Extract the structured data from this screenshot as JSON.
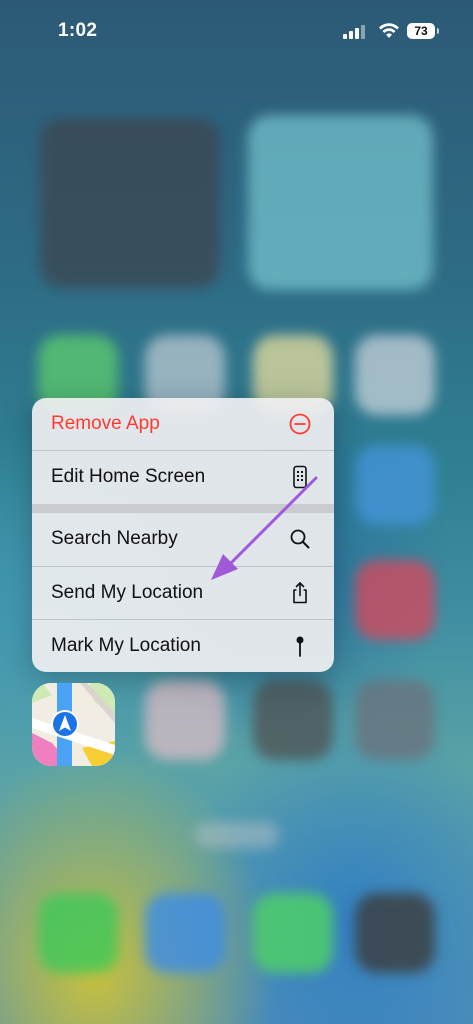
{
  "status_bar": {
    "time": "1:02",
    "battery": "73"
  },
  "context_menu": {
    "items": [
      {
        "label": "Remove App",
        "icon": "minus-circle-icon",
        "color": "#ff3b30"
      },
      {
        "label": "Edit Home Screen",
        "icon": "phone-app-grid-icon"
      },
      {
        "label": "Search Nearby",
        "icon": "search-icon"
      },
      {
        "label": "Send My Location",
        "icon": "share-icon"
      },
      {
        "label": "Mark My Location",
        "icon": "pin-icon"
      }
    ]
  },
  "app": {
    "name": "Maps",
    "icon": "maps-app-icon"
  },
  "annotation": {
    "icon": "arrow-annotation",
    "color": "#a05ad8"
  }
}
